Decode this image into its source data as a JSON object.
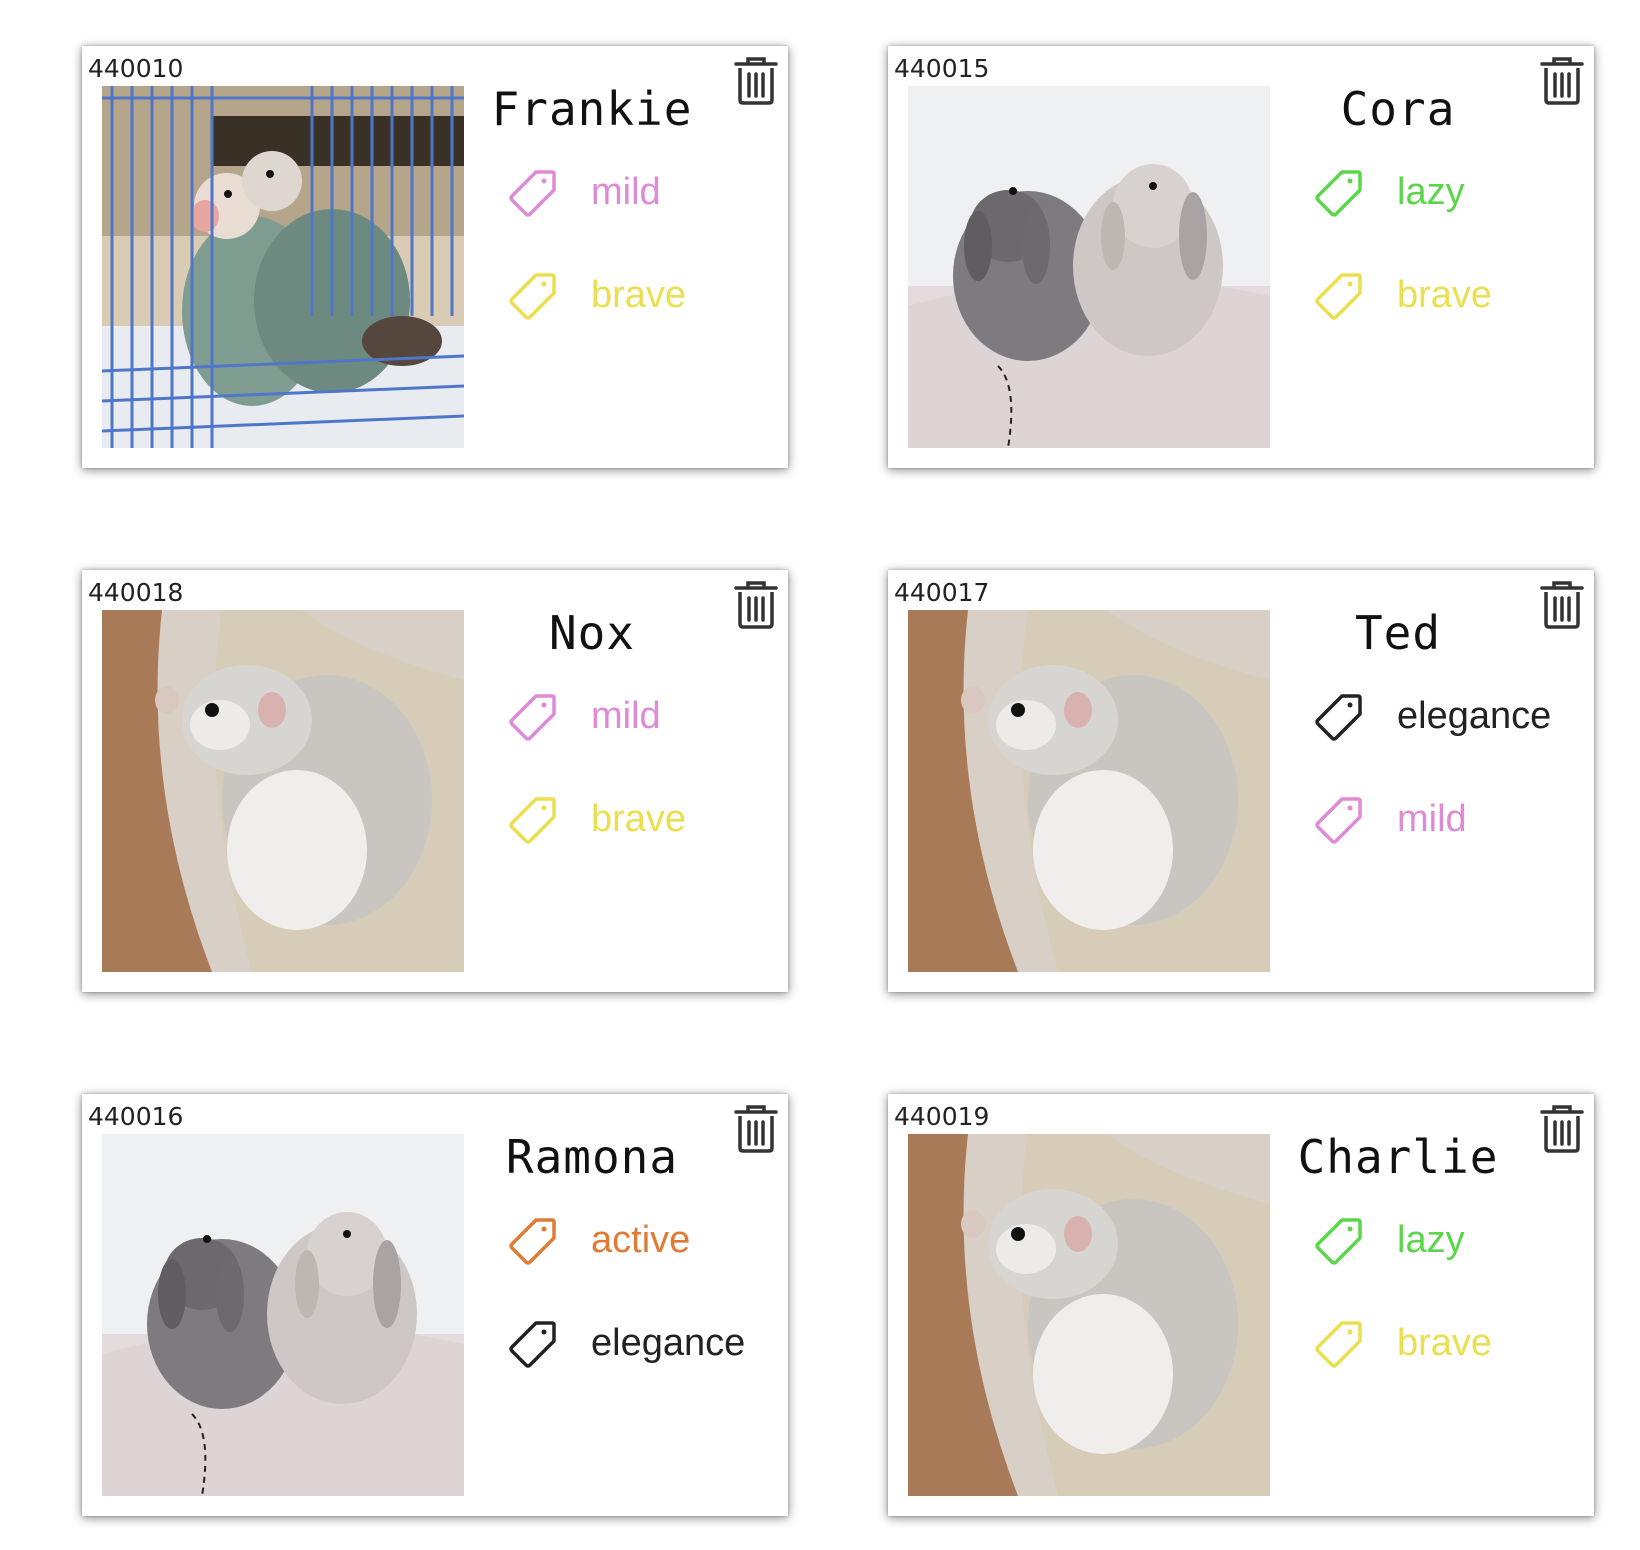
{
  "tag_colors": {
    "mild": "#e08ad6",
    "brave": "#eadf4f",
    "lazy": "#5bd64a",
    "elegance": "#222222",
    "active": "#e07a35"
  },
  "cards": [
    {
      "id": "440010",
      "name": "Frankie",
      "photo": "lovebirds-photo",
      "tags": [
        {
          "label": "mild",
          "color": "mild"
        },
        {
          "label": "brave",
          "color": "brave"
        }
      ]
    },
    {
      "id": "440015",
      "name": "Cora",
      "photo": "rabbits-photo",
      "tags": [
        {
          "label": "lazy",
          "color": "lazy"
        },
        {
          "label": "brave",
          "color": "brave"
        }
      ]
    },
    {
      "id": "440018",
      "name": "Nox",
      "photo": "hamster-photo",
      "tags": [
        {
          "label": "mild",
          "color": "mild"
        },
        {
          "label": "brave",
          "color": "brave"
        }
      ]
    },
    {
      "id": "440017",
      "name": "Ted",
      "photo": "hamster-photo",
      "tags": [
        {
          "label": "elegance",
          "color": "elegance"
        },
        {
          "label": "mild",
          "color": "mild"
        }
      ]
    },
    {
      "id": "440016",
      "name": "Ramona",
      "photo": "rabbits-photo",
      "tags": [
        {
          "label": "active",
          "color": "active"
        },
        {
          "label": "elegance",
          "color": "elegance"
        }
      ]
    },
    {
      "id": "440019",
      "name": "Charlie",
      "photo": "hamster-photo",
      "tags": [
        {
          "label": "lazy",
          "color": "lazy"
        },
        {
          "label": "brave",
          "color": "brave"
        }
      ]
    }
  ]
}
